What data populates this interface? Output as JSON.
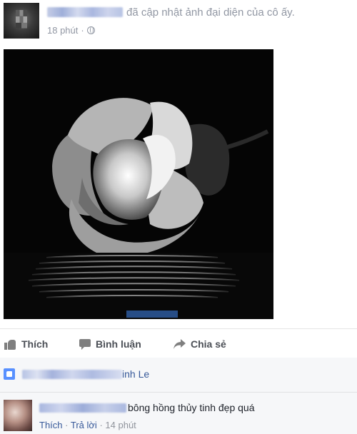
{
  "post": {
    "action_text": "đã cập nhật ảnh đại diện của cô ấy.",
    "timestamp": "18 phút",
    "separator": "·",
    "privacy_icon": "globe-icon"
  },
  "actions": {
    "like_label": "Thích",
    "comment_label": "Bình luận",
    "share_label": "Chia sẻ"
  },
  "likes": {
    "names_tail": "inh Le"
  },
  "comment": {
    "text": "bông hồng thủy tinh đẹp quá",
    "like_label": "Thích",
    "reply_label": "Trả lời",
    "separator": "·",
    "time": "14 phút"
  },
  "colors": {
    "link": "#365899",
    "meta": "#9197a3",
    "like_badge": "#5890ff",
    "comments_bg": "#f6f7f9"
  }
}
